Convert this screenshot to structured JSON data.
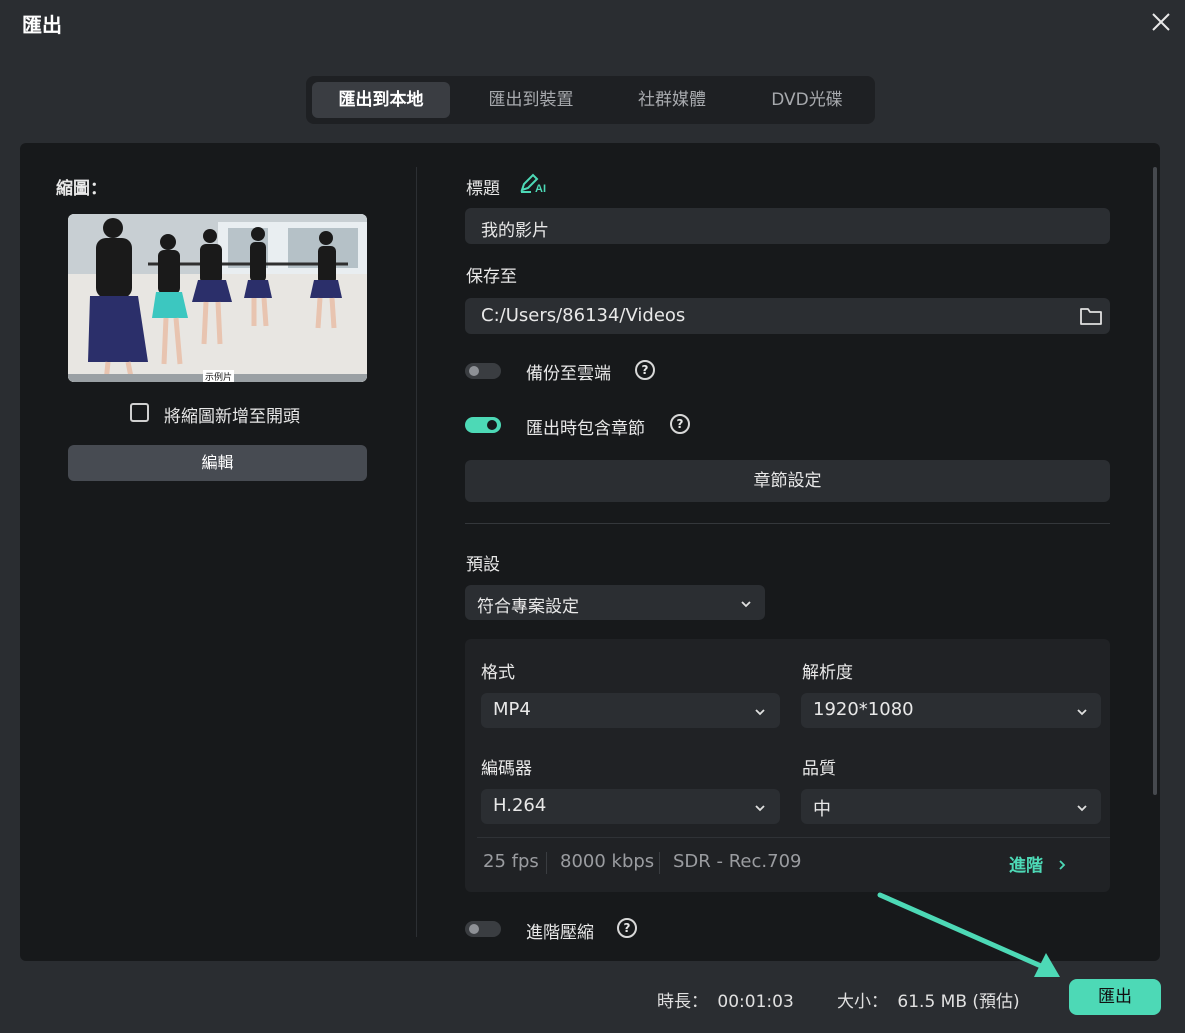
{
  "dialog": {
    "title": "匯出"
  },
  "tabs": [
    {
      "label": "匯出到本地",
      "active": true
    },
    {
      "label": "匯出到裝置",
      "active": false
    },
    {
      "label": "社群媒體",
      "active": false
    },
    {
      "label": "DVD光碟",
      "active": false
    }
  ],
  "thumbnail": {
    "label": "縮圖：",
    "add_to_start_label": "將縮圖新增至開頭",
    "edit_label": "編輯",
    "caption": "示例片"
  },
  "form": {
    "title_label": "標題",
    "ai_badge": "AI",
    "title_value": "我的影片",
    "save_to_label": "保存至",
    "save_path": "C:/Users/86134/Videos",
    "backup_label": "備份至雲端",
    "backup_on": false,
    "chapters_label": "匯出時包含章節",
    "chapters_on": true,
    "chapter_settings_label": "章節設定",
    "preset_label": "預設",
    "preset_value": "符合專案設定",
    "advanced_compress_label": "進階壓縮",
    "advanced_compress_on": false,
    "help_glyph": "?"
  },
  "settings": {
    "format_label": "格式",
    "format_value": "MP4",
    "resolution_label": "解析度",
    "resolution_value": "1920*1080",
    "encoder_label": "編碼器",
    "encoder_value": "H.264",
    "quality_label": "品質",
    "quality_value": "中",
    "fps": "25 fps",
    "bitrate": "8000 kbps",
    "color": "SDR - Rec.709",
    "advanced_label": "進階"
  },
  "footer": {
    "duration_label": "時長：",
    "duration_value": "00:01:03",
    "size_label": "大小：",
    "size_value": "61.5 MB (預估)",
    "export_label": "匯出"
  },
  "colors": {
    "accent": "#4dd9b6",
    "panel": "#17191b",
    "background": "#2a2d31"
  }
}
